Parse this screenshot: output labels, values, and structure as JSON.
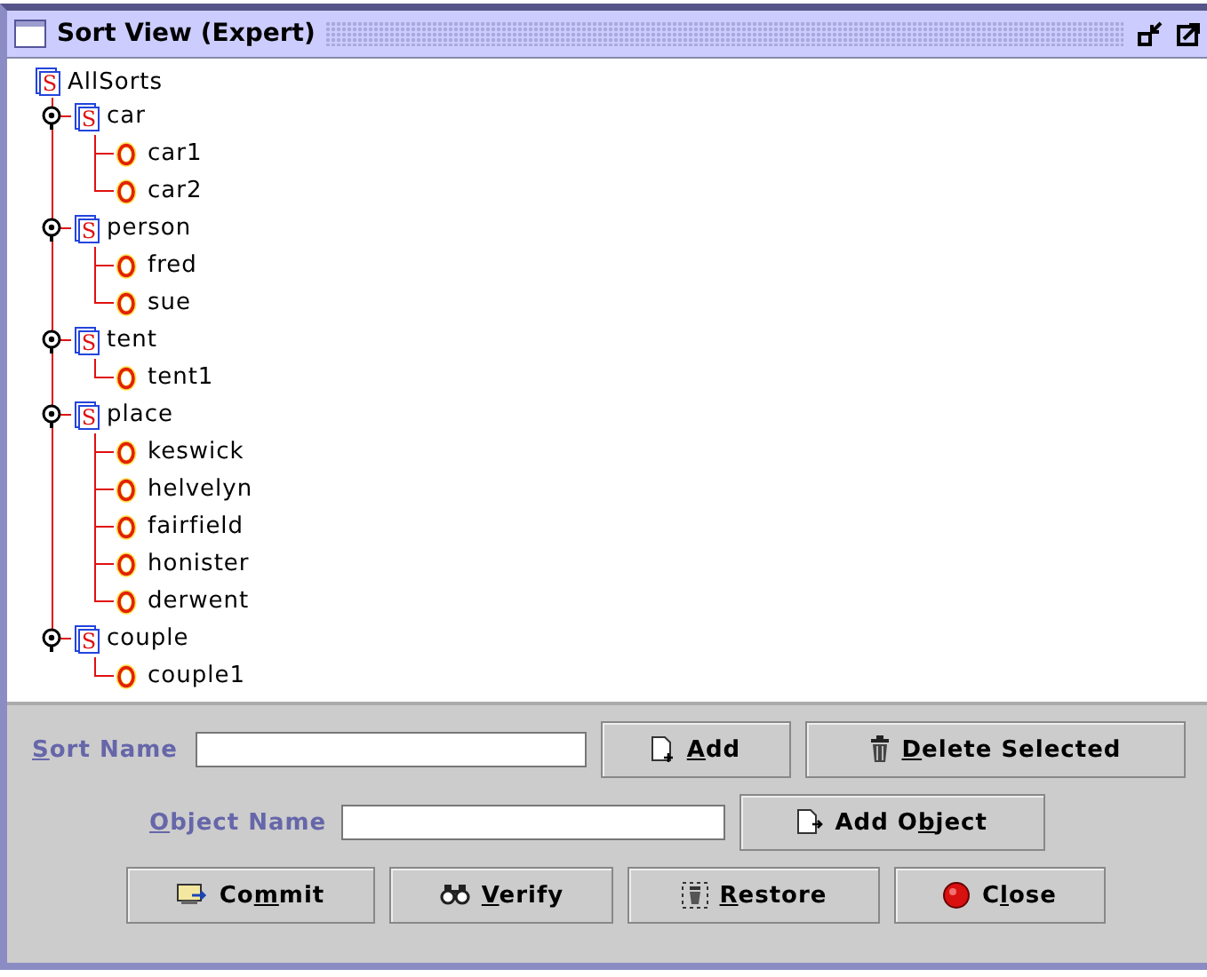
{
  "window": {
    "title": "Sort View (Expert)"
  },
  "tree": {
    "root": {
      "label": "AllSorts",
      "badge": "S"
    },
    "sorts": [
      {
        "label": "car",
        "badge": "S",
        "expanded": true,
        "children": [
          {
            "label": "car1"
          },
          {
            "label": "car2"
          }
        ]
      },
      {
        "label": "person",
        "badge": "S",
        "expanded": true,
        "children": [
          {
            "label": "fred"
          },
          {
            "label": "sue"
          }
        ]
      },
      {
        "label": "tent",
        "badge": "S",
        "expanded": true,
        "children": [
          {
            "label": "tent1"
          }
        ]
      },
      {
        "label": "place",
        "badge": "S",
        "expanded": true,
        "children": [
          {
            "label": "keswick"
          },
          {
            "label": "helvelyn"
          },
          {
            "label": "fairfield"
          },
          {
            "label": "honister"
          },
          {
            "label": "derwent"
          }
        ]
      },
      {
        "label": "couple",
        "badge": "S",
        "expanded": true,
        "children": [
          {
            "label": "couple1"
          }
        ]
      }
    ]
  },
  "form": {
    "sort_name": {
      "label": {
        "key": "S",
        "post": "ort Name"
      }
    },
    "object_name": {
      "label": {
        "key": "O",
        "post": "bject Name"
      }
    },
    "add": {
      "kind": "add",
      "key": "A",
      "post": "dd"
    },
    "delete": {
      "kind": "delete",
      "key": "D",
      "post": "elete Selected"
    },
    "add_object": {
      "kind": "add-object",
      "pre": "Add O",
      "key": "b",
      "post": "ject"
    },
    "buttons": [
      {
        "kind": "commit",
        "pre": "Co",
        "key": "m",
        "post": "mit"
      },
      {
        "kind": "verify",
        "key": "V",
        "post": "erify"
      },
      {
        "kind": "restore",
        "key": "R",
        "post": "estore"
      },
      {
        "kind": "close",
        "pre": "C",
        "key": "l",
        "post": "ose"
      }
    ]
  }
}
